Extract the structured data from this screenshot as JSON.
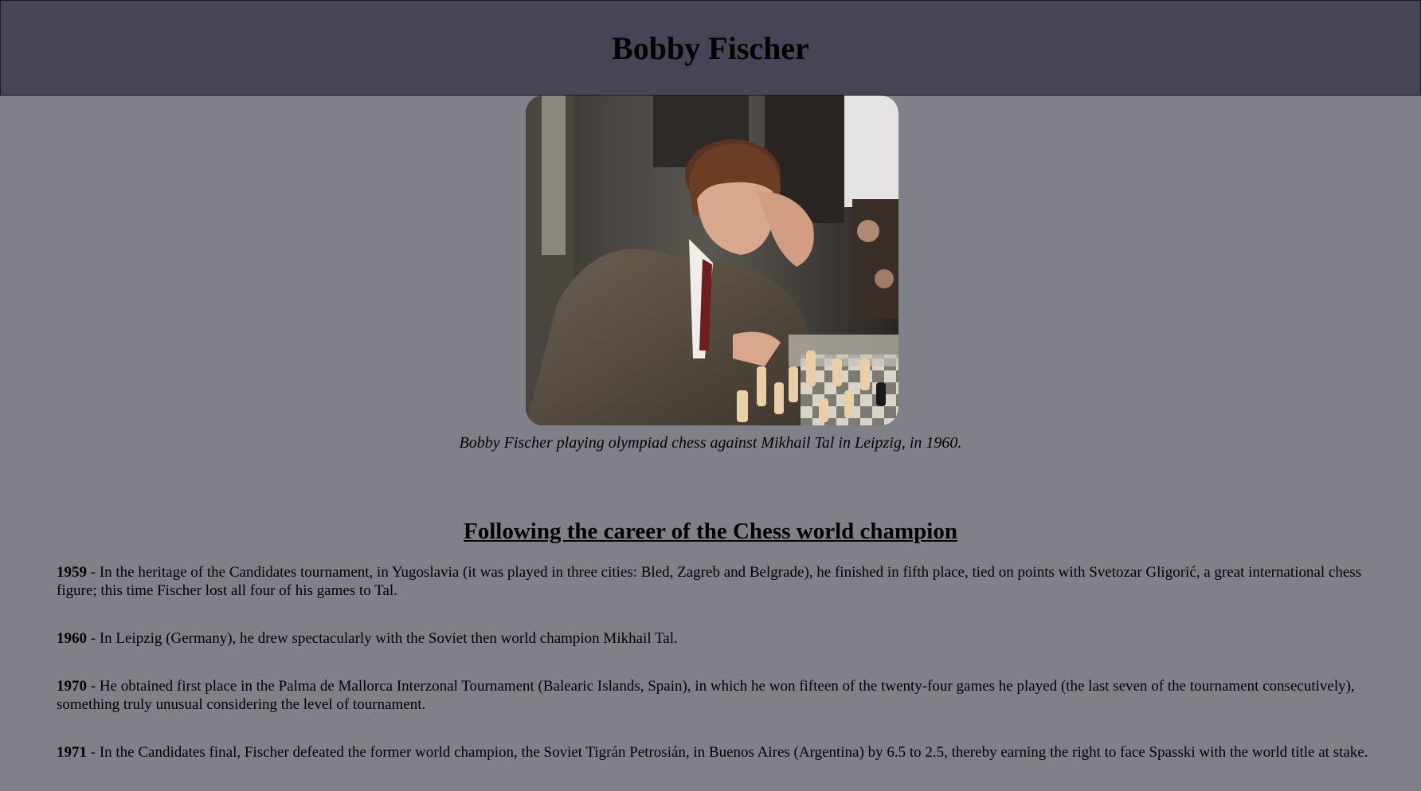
{
  "header": {
    "title": "Bobby Fischer"
  },
  "photo": {
    "description_icon": "chess-player-photo",
    "caption": "Bobby Fischer playing olympiad chess against Mikhail Tal in Leipzig, in 1960."
  },
  "career": {
    "heading": "Following the career of the Chess world champion",
    "entries": [
      {
        "year": "1959",
        "sep": " - ",
        "text": "In the heritage of the Candidates tournament, in Yugoslavia (it was played in three cities: Bled, Zagreb and Belgrade), he finished in fifth place, tied on points with Svetozar Gligorić, a great international chess figure; this time Fischer lost all four of his games to Tal."
      },
      {
        "year": "1960",
        "sep": " - ",
        "text": "In Leipzig (Germany), he drew spectacularly with the Soviet then world champion Mikhail Tal."
      },
      {
        "year": "1970",
        "sep": " - ",
        "text": "He obtained first place in the Palma de Mallorca Interzonal Tournament (Balearic Islands, Spain), in which he won fifteen of the twenty-four games he played (the last seven of the tournament consecutively), something truly unusual considering the level of tournament."
      },
      {
        "year": "1971",
        "sep": " - ",
        "text": "In the Candidates final, Fischer defeated the former world champion, the Soviet Tigrán Petrosián, in Buenos Aires (Argentina) by 6.5 to 2.5, thereby earning the right to face Spasski with the world title at stake."
      }
    ]
  },
  "colors": {
    "page_bg": "#808089",
    "header_bg": "#454556"
  }
}
